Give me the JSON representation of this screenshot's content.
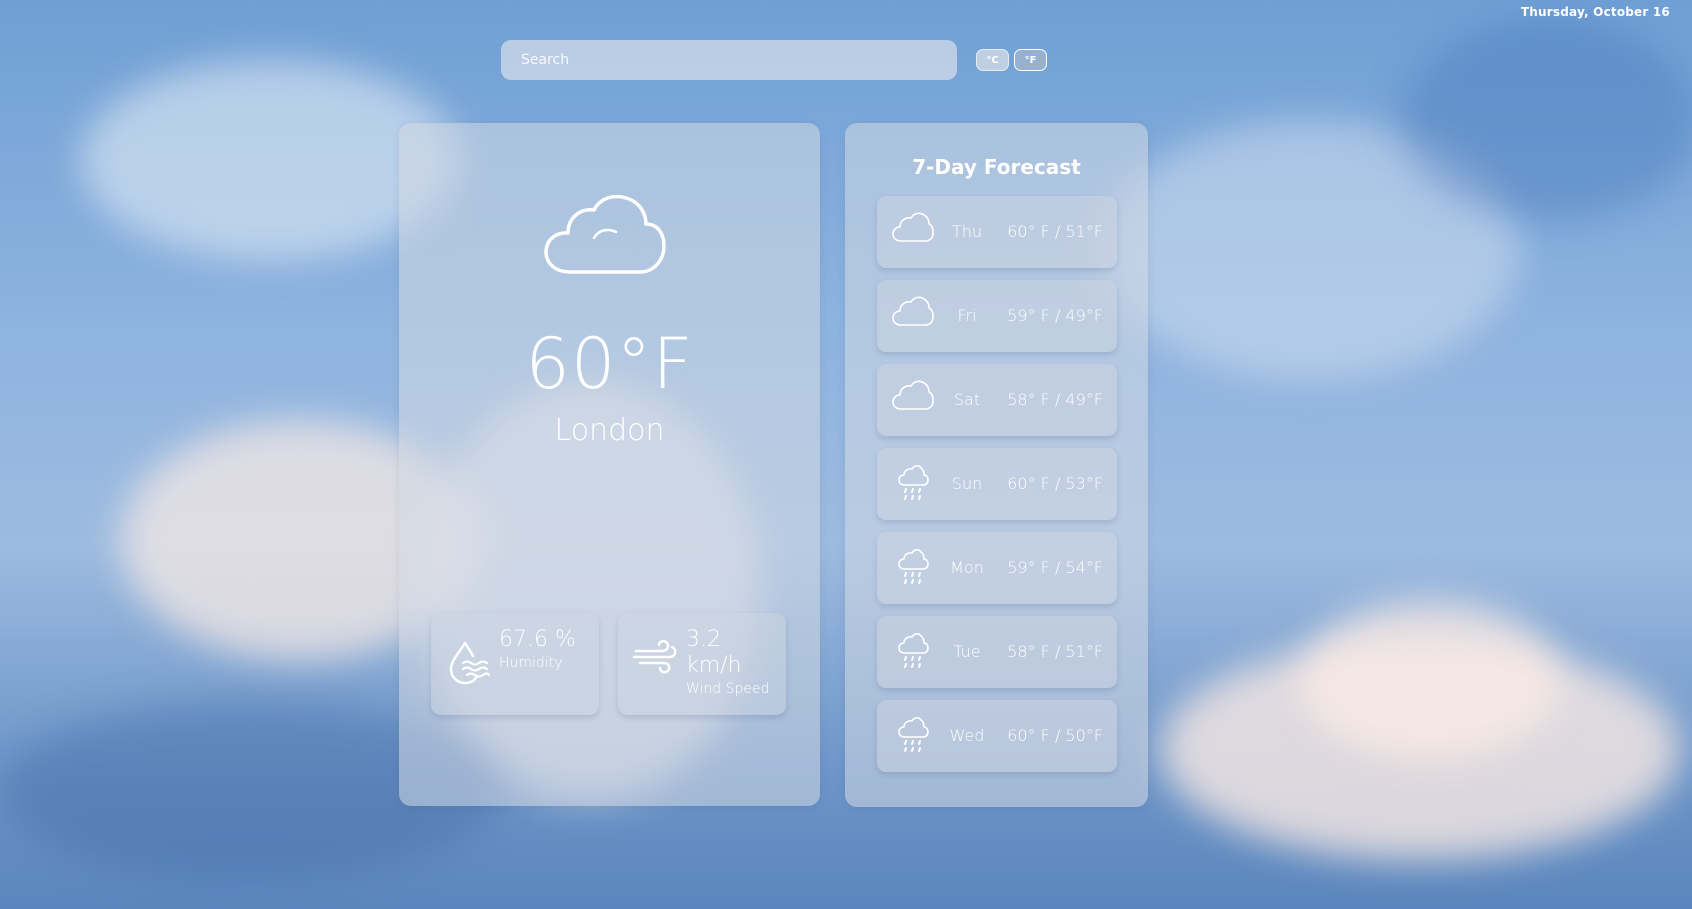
{
  "header": {
    "date": "Thursday, October 16"
  },
  "search": {
    "placeholder": "Search"
  },
  "units": {
    "celsius_label": "°C",
    "fahrenheit_label": "°F",
    "selected": "°F"
  },
  "current": {
    "icon": "cloud-icon",
    "temperature": "60°F",
    "city": "London",
    "humidity": {
      "icon": "humidity-icon",
      "value": "67.6 %",
      "label": "Humidity"
    },
    "wind": {
      "icon": "wind-icon",
      "value_line1": "3.2",
      "value_line2": "km/h",
      "label": "Wind Speed"
    }
  },
  "forecast": {
    "title": "7-Day Forecast",
    "days": [
      {
        "day": "Thu",
        "temps": "60° F / 51°F",
        "icon": "cloud-icon"
      },
      {
        "day": "Fri",
        "temps": "59° F / 49°F",
        "icon": "cloud-icon"
      },
      {
        "day": "Sat",
        "temps": "58° F / 49°F",
        "icon": "cloud-icon"
      },
      {
        "day": "Sun",
        "temps": "60° F / 53°F",
        "icon": "rain-icon"
      },
      {
        "day": "Mon",
        "temps": "59° F / 54°F",
        "icon": "rain-icon"
      },
      {
        "day": "Tue",
        "temps": "58° F / 51°F",
        "icon": "rain-icon"
      },
      {
        "day": "Wed",
        "temps": "60° F / 50°F",
        "icon": "rain-icon"
      }
    ]
  }
}
